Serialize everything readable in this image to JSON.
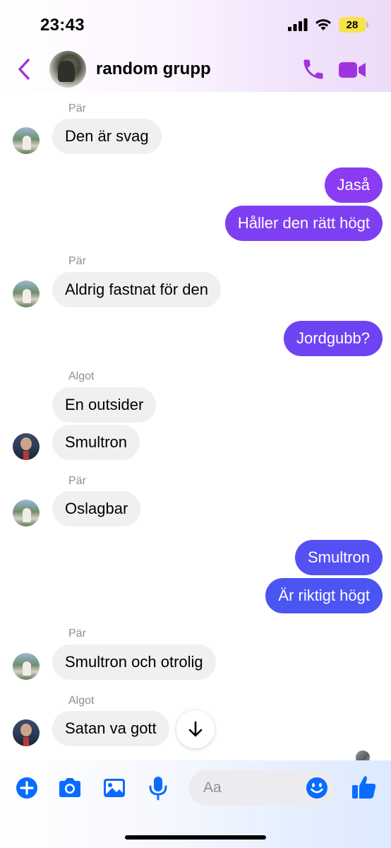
{
  "status_bar": {
    "time": "23:43",
    "battery": "28"
  },
  "header": {
    "title": "random grupp"
  },
  "messages": [
    {
      "id": "m1",
      "sender": "Pär",
      "text": "Den är svag",
      "direction": "in"
    },
    {
      "id": "m2",
      "text": "Jaså",
      "direction": "out"
    },
    {
      "id": "m3",
      "text": "Håller den rätt högt",
      "direction": "out"
    },
    {
      "id": "m4",
      "sender": "Pär",
      "text": "Aldrig fastnat för den",
      "direction": "in"
    },
    {
      "id": "m5",
      "text": "Jordgubb?",
      "direction": "out"
    },
    {
      "id": "m6",
      "sender": "Algot",
      "text": "En outsider",
      "direction": "in"
    },
    {
      "id": "m7",
      "text": "Smultron",
      "direction": "in"
    },
    {
      "id": "m8",
      "sender": "Pär",
      "text": "Oslagbar",
      "direction": "in"
    },
    {
      "id": "m9",
      "text": "Smultron",
      "direction": "out"
    },
    {
      "id": "m10",
      "text": "Är riktigt högt",
      "direction": "out"
    },
    {
      "id": "m11",
      "sender": "Pär",
      "text": "Smultron och otrolig",
      "direction": "in"
    },
    {
      "id": "m12",
      "sender": "Algot",
      "text": "Satan va gott",
      "direction": "in"
    }
  ],
  "composer": {
    "placeholder": "Aa"
  },
  "colors": {
    "accent": "#a033e0",
    "outgoing_top": "#8a3cf2",
    "outgoing_mid": "#6a45f3",
    "outgoing_bottom": "#4a55f2",
    "incoming": "#f0f0f0",
    "toolbar_icon": "#0a6cff"
  },
  "icons": [
    "back-chevron",
    "phone",
    "video-camera",
    "arrow-down",
    "plus",
    "camera",
    "image",
    "microphone",
    "smile",
    "thumbs-up"
  ]
}
